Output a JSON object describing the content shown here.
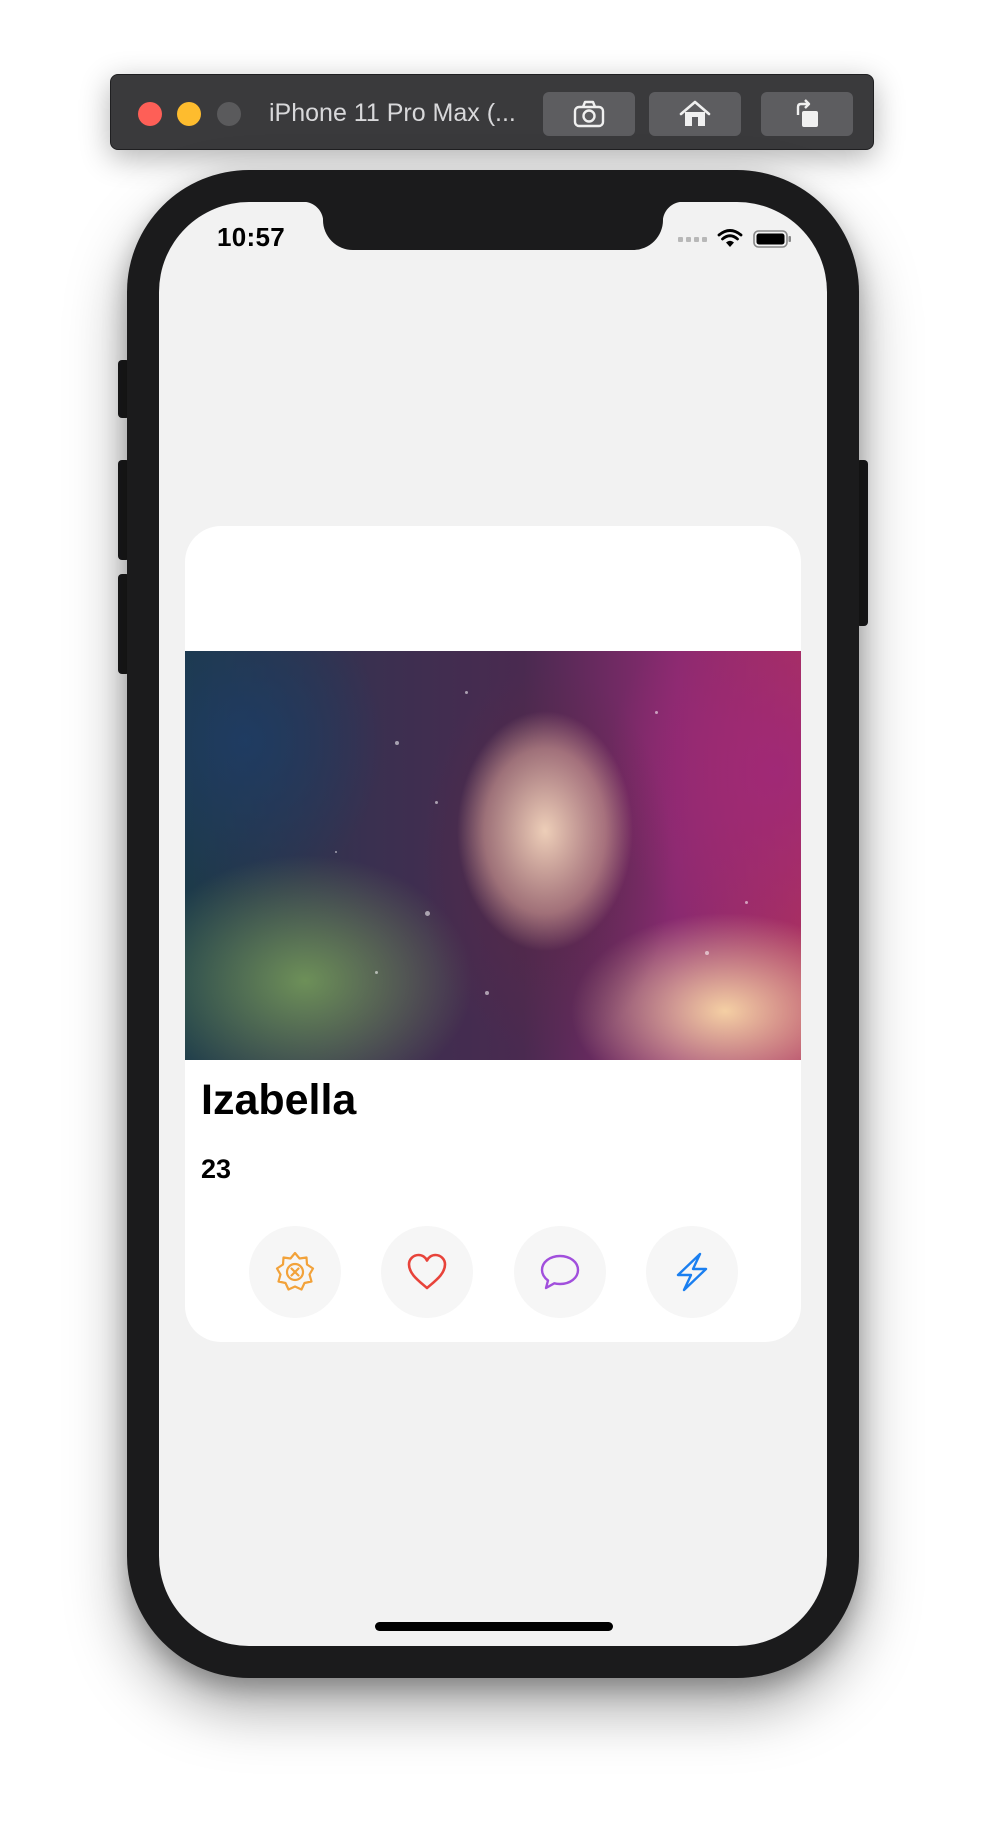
{
  "simulator": {
    "window_title": "iPhone 11 Pro Max (...",
    "buttons": {
      "screenshot_icon": "camera-icon",
      "home_icon": "home-icon",
      "rotate_icon": "rotate-icon"
    }
  },
  "status_bar": {
    "time": "10:57",
    "wifi_icon": "wifi-icon",
    "battery_icon": "battery-icon"
  },
  "profile_card": {
    "photo_description": "portrait photo",
    "name": "Izabella",
    "age": "23",
    "actions": [
      {
        "name": "skip",
        "icon": "x-badge-icon",
        "color": "#f2a23a"
      },
      {
        "name": "like",
        "icon": "heart-icon",
        "color": "#e8433a"
      },
      {
        "name": "message",
        "icon": "chat-bubble-icon",
        "color": "#a14fdc"
      },
      {
        "name": "boost",
        "icon": "bolt-icon",
        "color": "#1a7ff0"
      }
    ]
  },
  "colors": {
    "screen_background": "#f2f2f2",
    "card_background": "#ffffff",
    "button_background": "#f6f6f6"
  }
}
